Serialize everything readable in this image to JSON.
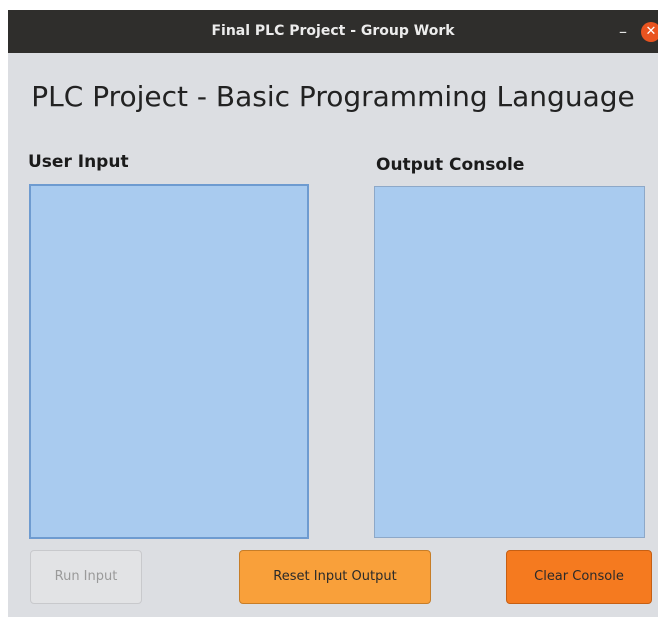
{
  "window": {
    "title": "Final PLC Project  - Group Work",
    "minimize_glyph": "–",
    "close_glyph": "✕"
  },
  "main": {
    "heading": "PLC Project - Basic Programming Language",
    "user_input": {
      "label": "User Input",
      "value": ""
    },
    "output_console": {
      "label": "Output Console",
      "value": ""
    }
  },
  "buttons": {
    "run": "Run Input",
    "reset": "Reset Input Output",
    "clear": "Clear Console"
  },
  "colors": {
    "titlebar": "#2f2e2c",
    "background": "#dcdee2",
    "panel": "#a9cbef",
    "reset_button": "#f9a03a",
    "clear_button": "#f57a1f",
    "close_button": "#e95420"
  },
  "icons": {
    "minimize": "minimize-icon",
    "close": "close-icon"
  }
}
